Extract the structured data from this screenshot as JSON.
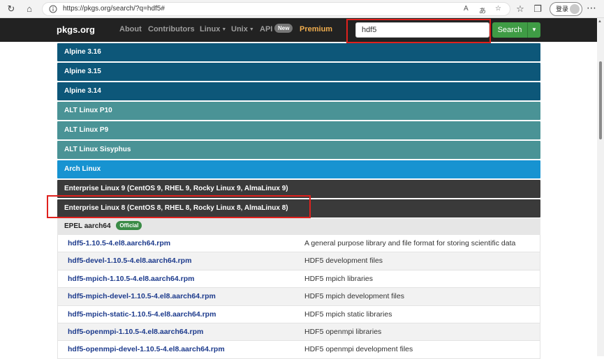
{
  "browser": {
    "url": "https://pkgs.org/search/?q=hdf5#",
    "login_label": "登录"
  },
  "nav": {
    "brand": "pkgs.org",
    "about": "About",
    "contributors": "Contributors",
    "linux": "Linux",
    "unix": "Unix",
    "api": "API",
    "new_badge": "New",
    "premium": "Premium",
    "search_value": "hdf5",
    "search_button": "Search"
  },
  "repos": [
    {
      "label": "Alpine 3.16",
      "color": "#0d5779"
    },
    {
      "label": "Alpine 3.15",
      "color": "#0d5779"
    },
    {
      "label": "Alpine 3.14",
      "color": "#0d5779"
    },
    {
      "label": "ALT Linux P10",
      "color": "#4a9396"
    },
    {
      "label": "ALT Linux P9",
      "color": "#4a9396"
    },
    {
      "label": "ALT Linux Sisyphus",
      "color": "#4a9396"
    },
    {
      "label": "Arch Linux",
      "color": "#1793d1"
    },
    {
      "label": "Enterprise Linux 9 (CentOS 9, RHEL 9, Rocky Linux 9, AlmaLinux 9)",
      "color": "#3a3a3a"
    },
    {
      "label": "Enterprise Linux 8 (CentOS 8, RHEL 8, Rocky Linux 8, AlmaLinux 8)",
      "color": "#3a3a3a"
    }
  ],
  "subrepo": {
    "label": "EPEL aarch64",
    "badge": "Official"
  },
  "packages": [
    {
      "name": "hdf5-1.10.5-4.el8.aarch64.rpm",
      "desc": "A general purpose library and file format for storing scientific data"
    },
    {
      "name": "hdf5-devel-1.10.5-4.el8.aarch64.rpm",
      "desc": "HDF5 development files"
    },
    {
      "name": "hdf5-mpich-1.10.5-4.el8.aarch64.rpm",
      "desc": "HDF5 mpich libraries"
    },
    {
      "name": "hdf5-mpich-devel-1.10.5-4.el8.aarch64.rpm",
      "desc": "HDF5 mpich development files"
    },
    {
      "name": "hdf5-mpich-static-1.10.5-4.el8.aarch64.rpm",
      "desc": "HDF5 mpich static libraries"
    },
    {
      "name": "hdf5-openmpi-1.10.5-4.el8.aarch64.rpm",
      "desc": "HDF5 openmpi libraries"
    },
    {
      "name": "hdf5-openmpi-devel-1.10.5-4.el8.aarch64.rpm",
      "desc": "HDF5 openmpi development files"
    }
  ],
  "colors": {
    "highlight": "#e0211d",
    "search_green": "#3f9c45",
    "navbar": "#222222"
  }
}
